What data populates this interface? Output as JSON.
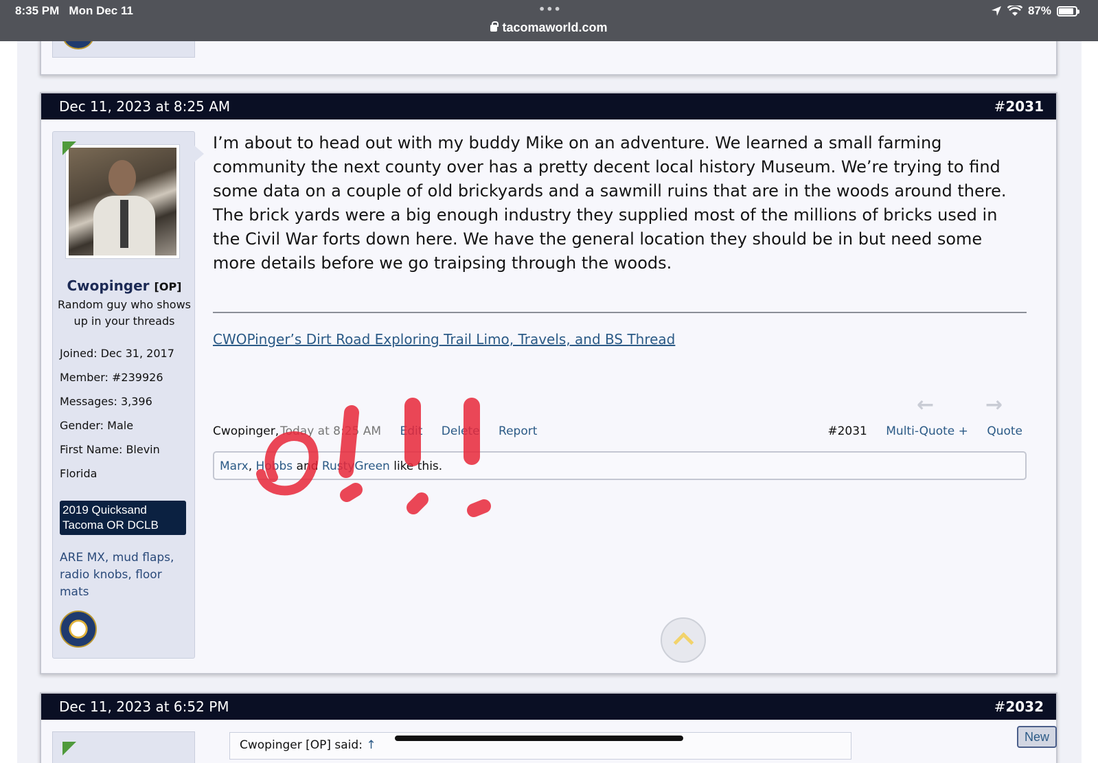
{
  "status_bar": {
    "time": "8:35 PM",
    "date": "Mon Dec 11",
    "url": "tacomaworld.com",
    "battery": "87%"
  },
  "posts": [
    {
      "date": "Dec 11, 2023 at 8:25 AM",
      "number_prefix": "#",
      "number": "2031",
      "author": {
        "name": "Cwopinger",
        "badge": "[OP]",
        "title": "Random guy who shows up in your threads",
        "facts": [
          "Joined: Dec 31, 2017",
          "Member: #239926",
          "Messages: 3,396",
          "Gender: Male",
          "First Name: Blevin",
          "Florida"
        ],
        "vehicle": "2019 Quicksand Tacoma OR DCLB",
        "mods": "ARE MX, mud flaps, radio knobs, floor mats"
      },
      "message": "I’m about to head out with my buddy Mike on an adventure. We learned a small farming community the next county over has a pretty decent local history Museum. We’re trying to find some data on a couple of old brickyards and a sawmill ruins that are in the woods around there. The brick yards were a big enough industry they supplied most of the millions of bricks used in the Civil War forts down here. We have the general location they should be in but need some more details before we go traipsing through the woods.",
      "signature_link": "CWOPinger’s Dirt Road Exploring Trail Limo, Travels, and BS Thread",
      "meta": {
        "author": "Cwopinger,",
        "time": "Today at 8:25 AM",
        "edit": "Edit",
        "delete": "Delete",
        "report": "Report",
        "post_ref": "#2031",
        "multi_quote": "Multi-Quote +",
        "quote": "Quote"
      },
      "likes": {
        "user1": "Marx",
        "sep1": ", ",
        "user2": "Hobbs",
        "and": " and ",
        "user3": "RustyGreen",
        "suffix": " like this."
      },
      "annotation": "O!!!"
    },
    {
      "date": "Dec 11, 2023 at 6:52 PM",
      "number_prefix": "#",
      "number": "2032",
      "quote_header": "Cwopinger [OP] said:",
      "quote_arrow": "↑"
    }
  ],
  "new_button": "New",
  "icons": {
    "prev": "arrow-left-icon",
    "next": "arrow-right-icon",
    "scroll_top": "chevron-up-icon"
  },
  "colors": {
    "header_bg": "#0a0f24",
    "link": "#2b5a86",
    "vehicle_bg": "#0b2141",
    "ink": "#e8283a"
  }
}
